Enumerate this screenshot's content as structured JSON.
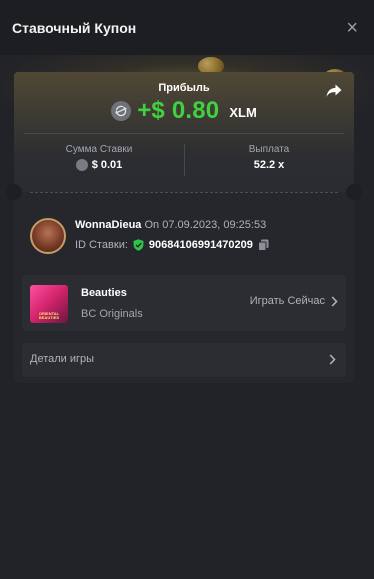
{
  "header": {
    "title": "Ставочный Купон",
    "close_symbol": "×"
  },
  "profit": {
    "label": "Прибыль",
    "amount": "+$ 0.80",
    "currency": "XLM",
    "amount_color": "#3fd13f"
  },
  "stats": {
    "bet_amount_label": "Сумма Ставки",
    "bet_amount_value": "$ 0.01",
    "payout_label": "Выплата",
    "payout_value": "52.2 x"
  },
  "user": {
    "name": "WonnaDieua",
    "time": "On 07.09.2023, 09:25:53",
    "bet_id_label": "ID Ставки:",
    "bet_id": "90684106991470209"
  },
  "game": {
    "name": "Beauties",
    "provider": "BC Originals",
    "play_label": "Играть Сейчас",
    "thumb_text": "ORIENTAL BEAUTIES"
  },
  "details": {
    "label": "Детали игры"
  }
}
